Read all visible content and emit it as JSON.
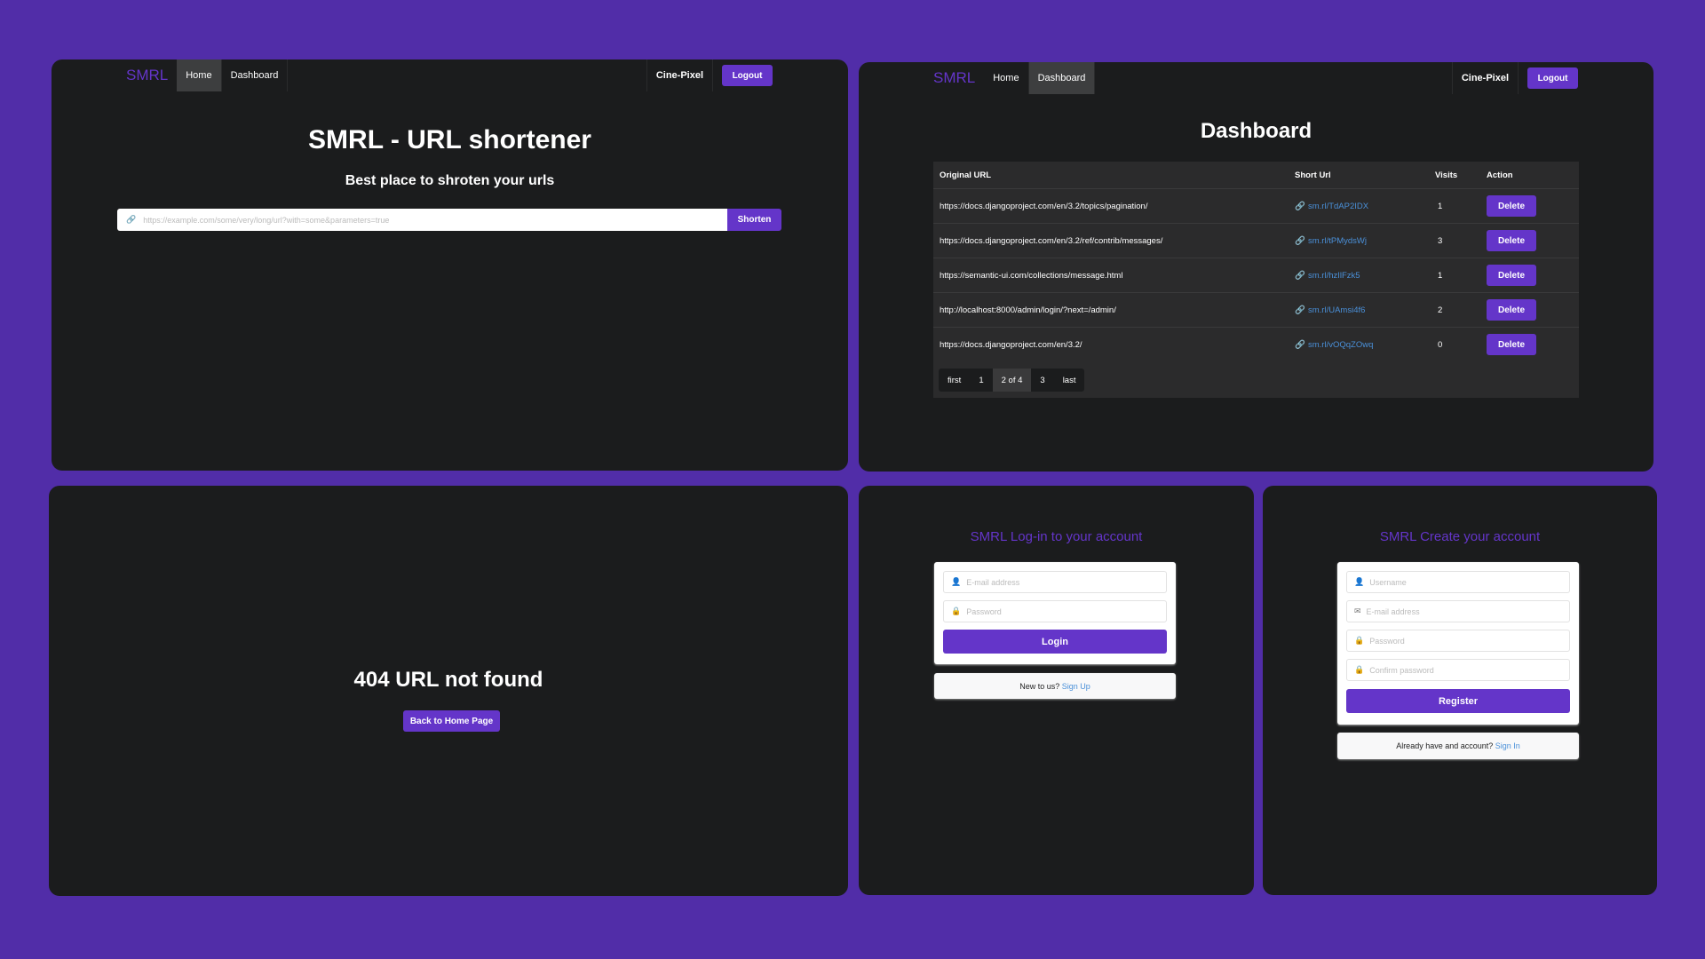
{
  "colors": {
    "background": "#512da8",
    "panel": "#1b1c1d",
    "accent": "#6435c9",
    "link": "#4a90d9"
  },
  "nav": {
    "logo": "SMRL",
    "home": "Home",
    "dashboard": "Dashboard",
    "user": "Cine-Pixel",
    "logout": "Logout"
  },
  "home": {
    "title": "SMRL - URL shortener",
    "subtitle": "Best place to shroten your urls",
    "input_placeholder": "https://example.com/some/very/long/url?with=some&parameters=true",
    "input_icon": "link-icon",
    "shorten": "Shorten"
  },
  "dashboard": {
    "title": "Dashboard",
    "headers": [
      "Original URL",
      "Short Url",
      "Visits",
      "Action"
    ],
    "rows": [
      {
        "original": "https://docs.djangoproject.com/en/3.2/topics/pagination/",
        "short": "sm.rl/TdAP2IDX",
        "visits": "1",
        "action": "Delete"
      },
      {
        "original": "https://docs.djangoproject.com/en/3.2/ref/contrib/messages/",
        "short": "sm.rl/tPMydsWj",
        "visits": "3",
        "action": "Delete"
      },
      {
        "original": "https://semantic-ui.com/collections/message.html",
        "short": "sm.rl/hzIlFzk5",
        "visits": "1",
        "action": "Delete"
      },
      {
        "original": "http://localhost:8000/admin/login/?next=/admin/",
        "short": "sm.rl/UAmsi4f6",
        "visits": "2",
        "action": "Delete"
      },
      {
        "original": "https://docs.djangoproject.com/en/3.2/",
        "short": "sm.rl/vOQqZOwq",
        "visits": "0",
        "action": "Delete"
      }
    ],
    "pagination": [
      "first",
      "1",
      "2 of 4",
      "3",
      "last"
    ]
  },
  "notfound": {
    "title": "404 URL not found",
    "button": "Back to Home Page"
  },
  "login": {
    "title": "SMRL Log-in to your account",
    "email": "E-mail address",
    "password": "Password",
    "button": "Login",
    "message": "New to us?",
    "link": "Sign Up"
  },
  "register": {
    "title": "SMRL Create your account",
    "username": "Username",
    "email": "E-mail address",
    "password": "Password",
    "confirm": "Confirm password",
    "button": "Register",
    "message": "Already have and account?",
    "link": "Sign In"
  }
}
